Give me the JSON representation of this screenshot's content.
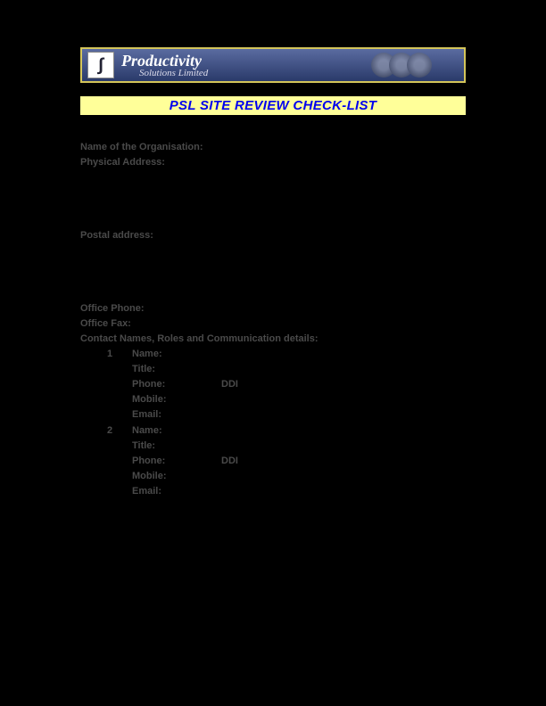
{
  "banner": {
    "title": "Productivity",
    "subtitle": "Solutions Limited"
  },
  "titleBar": "PSL SITE REVIEW CHECK-LIST",
  "form": {
    "orgLabel": "Name of the Organisation:",
    "physAddrLabel": "Physical Address:",
    "postalAddrLabel": "Postal address:",
    "officePhoneLabel": "Office Phone:",
    "officeFaxLabel": "Office Fax:",
    "contactHeading": "Contact Names, Roles and Communication details:",
    "contacts": [
      {
        "num": "1",
        "nameLabel": "Name:",
        "titleLabel": "Title:",
        "phoneLabel": "Phone:",
        "ddiLabel": "DDI",
        "mobileLabel": "Mobile:",
        "emailLabel": "Email:"
      },
      {
        "num": "2",
        "nameLabel": "Name:",
        "titleLabel": "Title:",
        "phoneLabel": "Phone:",
        "ddiLabel": "DDI",
        "mobileLabel": "Mobile:",
        "emailLabel": "Email:"
      }
    ]
  }
}
